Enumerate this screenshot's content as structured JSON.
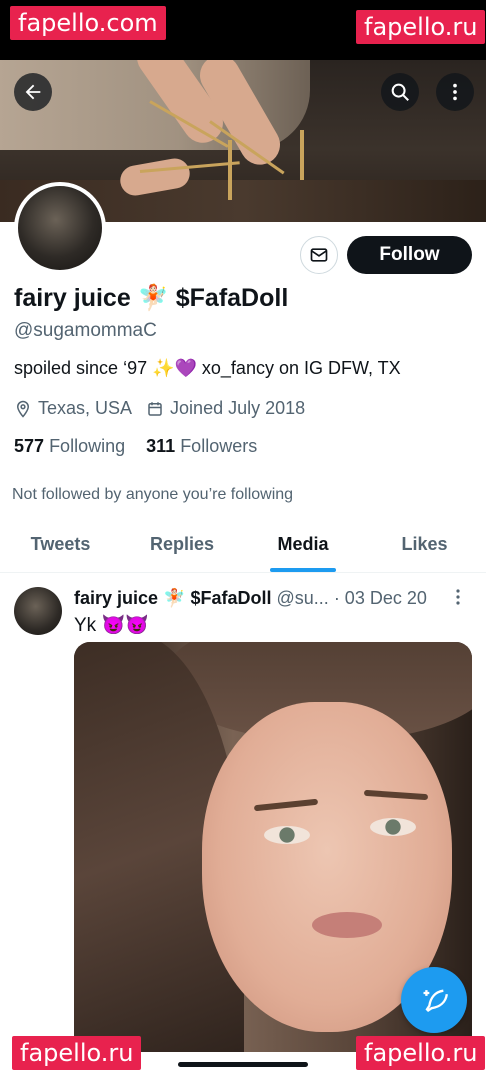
{
  "watermarks": {
    "top_left": "fapello.com",
    "top_right": "fapello.ru",
    "bottom_left": "fapello.ru",
    "bottom_right": "fapello.ru"
  },
  "profile": {
    "display_name": "fairy juice 🧚🏻 $FafaDoll",
    "handle": "@sugamommaC",
    "bio": "spoiled since ‘97 ✨💜 xo_fancy on IG   DFW, TX",
    "location": "Texas, USA",
    "joined": "Joined July 2018",
    "following_count": "577",
    "following_label": "Following",
    "followers_count": "311",
    "followers_label": "Followers",
    "not_followed_text": "Not followed by anyone you’re following",
    "follow_button": "Follow"
  },
  "tabs": [
    {
      "label": "Tweets",
      "active": false
    },
    {
      "label": "Replies",
      "active": false
    },
    {
      "label": "Media",
      "active": true
    },
    {
      "label": "Likes",
      "active": false
    }
  ],
  "tweet": {
    "author_name": "fairy juice 🧚🏻 $FafaDoll",
    "author_handle": "@su...",
    "date": "· 03 Dec 20",
    "text": "Yk 😈😈"
  },
  "icons": {
    "back": "back-arrow-icon",
    "search": "search-icon",
    "more": "more-vertical-icon",
    "message": "envelope-icon",
    "location": "location-pin-icon",
    "calendar": "calendar-icon",
    "compose": "compose-feather-icon"
  },
  "colors": {
    "accent": "#1d9bf0",
    "text_primary": "#0f1419",
    "text_secondary": "#536471",
    "watermark": "#e8224e"
  }
}
